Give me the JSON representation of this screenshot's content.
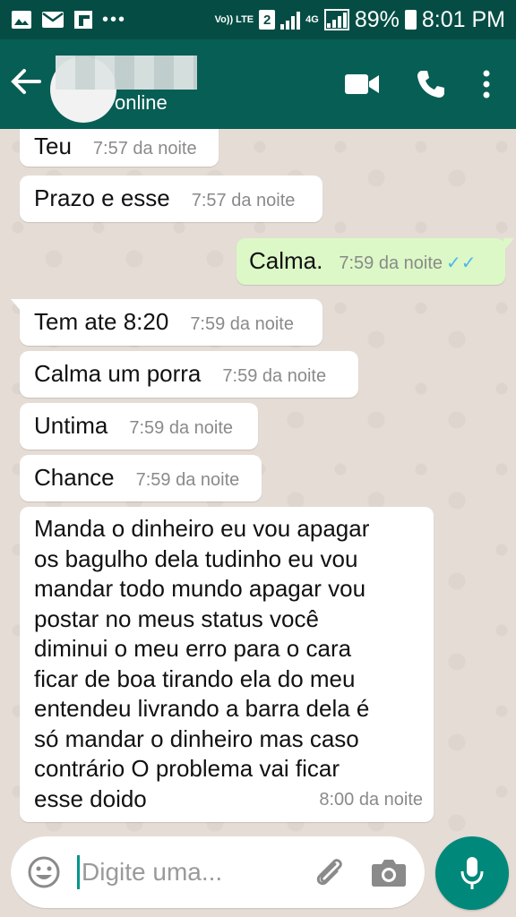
{
  "status_bar": {
    "volte": "Vo)) LTE",
    "sim_slot": "2",
    "network": "4G",
    "battery": "89%",
    "time": "8:01 PM"
  },
  "header": {
    "status": "online"
  },
  "messages": [
    {
      "text": "Teu",
      "time": "7:57 da noite"
    },
    {
      "text": "Prazo e esse",
      "time": "7:57 da noite"
    },
    {
      "text": "Calma.",
      "time": "7:59 da noite",
      "ticks": "✓✓"
    },
    {
      "text": "Tem ate 8:20",
      "time": "7:59 da noite"
    },
    {
      "text": "Calma um porra",
      "time": "7:59 da noite"
    },
    {
      "text": "Untima",
      "time": "7:59 da noite"
    },
    {
      "text": "Chance",
      "time": "7:59 da noite"
    },
    {
      "lines": [
        "Manda o dinheiro eu vou apagar",
        "os bagulho dela tudinho eu vou",
        "mandar todo mundo apagar vou",
        "postar no meus status você",
        "diminui o meu erro para o cara",
        "ficar de boa tirando ela do meu",
        "entendeu livrando a barra dela é",
        "só mandar o dinheiro mas caso",
        "contrário O problema vai ficar",
        "esse doido"
      ],
      "time": "8:00 da noite"
    }
  ],
  "composer": {
    "placeholder": "Digite uma..."
  },
  "colors": {
    "header": "#075e54",
    "status_bar": "#054d44",
    "outgoing_bubble": "#dcf8c6",
    "mic_button": "#00897b"
  }
}
